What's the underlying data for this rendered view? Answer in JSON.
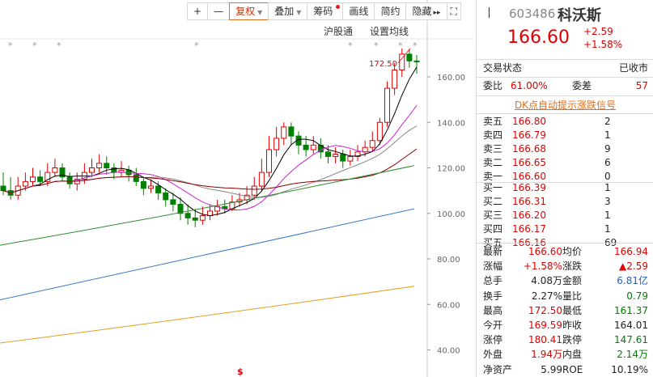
{
  "toolbar": {
    "plus": "+",
    "minus": "—",
    "fuquan": "复权",
    "diejia": "叠加",
    "chouma": "筹码",
    "huaxian": "画线",
    "jianyue": "简约",
    "yincang": "隐藏",
    "arrows": "▸▸",
    "expand": "⛶"
  },
  "chart_labels": {
    "hugutong": "沪股通",
    "setma": "设置均线",
    "max_price": "172.50",
    "s_marker": "$"
  },
  "yaxis": {
    "ticks": [
      "160.00",
      "140.00",
      "120.00",
      "100.00",
      "80.00",
      "60.00",
      "40.00"
    ]
  },
  "chart_data": {
    "type": "candlestick",
    "title": "",
    "ylim": [
      32,
      176
    ],
    "yticks": [
      160,
      140,
      120,
      100,
      80,
      60,
      40
    ],
    "candles": [
      [
        112,
        110,
        118,
        108
      ],
      [
        110,
        108,
        116,
        106
      ],
      [
        108,
        112,
        116,
        106
      ],
      [
        112,
        114,
        118,
        110
      ],
      [
        114,
        116,
        120,
        112
      ],
      [
        116,
        114,
        119,
        112
      ],
      [
        114,
        118,
        122,
        112
      ],
      [
        118,
        120,
        124,
        116
      ],
      [
        120,
        116,
        122,
        114
      ],
      [
        116,
        113,
        118,
        111
      ],
      [
        113,
        115,
        118,
        110
      ],
      [
        115,
        118,
        122,
        113
      ],
      [
        118,
        120,
        124,
        116
      ],
      [
        120,
        122,
        126,
        118
      ],
      [
        122,
        120,
        125,
        117
      ],
      [
        120,
        118,
        122,
        115
      ],
      [
        118,
        119,
        123,
        116
      ],
      [
        119,
        117,
        121,
        114
      ],
      [
        117,
        114,
        120,
        112
      ],
      [
        114,
        111,
        116,
        108
      ],
      [
        111,
        112,
        115,
        109
      ],
      [
        112,
        109,
        114,
        106
      ],
      [
        109,
        106,
        111,
        103
      ],
      [
        106,
        104,
        109,
        101
      ],
      [
        104,
        100,
        107,
        97
      ],
      [
        100,
        98,
        104,
        95
      ],
      [
        98,
        97,
        102,
        94
      ],
      [
        97,
        99,
        103,
        95
      ],
      [
        99,
        101,
        104,
        97
      ],
      [
        101,
        103,
        106,
        99
      ],
      [
        103,
        102,
        106,
        100
      ],
      [
        102,
        105,
        108,
        101
      ],
      [
        105,
        106,
        109,
        103
      ],
      [
        106,
        108,
        112,
        104
      ],
      [
        108,
        112,
        116,
        106
      ],
      [
        112,
        118,
        124,
        110
      ],
      [
        118,
        128,
        134,
        116
      ],
      [
        128,
        133,
        138,
        125
      ],
      [
        133,
        138,
        140,
        130
      ],
      [
        138,
        134,
        140,
        130
      ],
      [
        134,
        130,
        136,
        126
      ],
      [
        130,
        128,
        134,
        125
      ],
      [
        128,
        130,
        134,
        126
      ],
      [
        130,
        127,
        133,
        124
      ],
      [
        127,
        125,
        130,
        122
      ],
      [
        125,
        126,
        129,
        122
      ],
      [
        126,
        123,
        128,
        120
      ],
      [
        123,
        125,
        128,
        121
      ],
      [
        125,
        127,
        130,
        123
      ],
      [
        127,
        129,
        132,
        125
      ],
      [
        129,
        132,
        136,
        127
      ],
      [
        132,
        140,
        142,
        130
      ],
      [
        140,
        155,
        158,
        138
      ],
      [
        155,
        163,
        166,
        152
      ],
      [
        163,
        170,
        172.5,
        160
      ],
      [
        170,
        167,
        172,
        164
      ],
      [
        167,
        166.6,
        169.6,
        161.4
      ]
    ]
  },
  "quote": {
    "code": "603486",
    "name": "科沃斯",
    "price": "166.60",
    "change": "+2.59",
    "pct": "+1.58%",
    "status_label": "交易状态",
    "status_value": "已收市",
    "weibi_label": "委比",
    "weibi_value": "61.00%",
    "weicha_label": "委差",
    "weicha_value": "57",
    "dk_link": "DK点自动提示涨跌信号",
    "sell": [
      {
        "label": "卖五",
        "price": "166.80",
        "vol": "2"
      },
      {
        "label": "卖四",
        "price": "166.79",
        "vol": "1"
      },
      {
        "label": "卖三",
        "price": "166.68",
        "vol": "9"
      },
      {
        "label": "卖二",
        "price": "166.65",
        "vol": "6"
      },
      {
        "label": "卖一",
        "price": "166.60",
        "vol": "0"
      }
    ],
    "buy": [
      {
        "label": "买一",
        "price": "166.39",
        "vol": "1"
      },
      {
        "label": "买二",
        "price": "166.31",
        "vol": "3"
      },
      {
        "label": "买三",
        "price": "166.20",
        "vol": "1"
      },
      {
        "label": "买四",
        "price": "166.17",
        "vol": "1"
      },
      {
        "label": "买五",
        "price": "166.16",
        "vol": "69"
      }
    ],
    "stats": [
      {
        "l1": "最新",
        "v1": "166.60",
        "c1": "red",
        "l2": "均价",
        "v2": "166.94",
        "c2": "red"
      },
      {
        "l1": "涨幅",
        "v1": "+1.58%",
        "c1": "red",
        "l2": "涨跌",
        "v2": "▲2.59",
        "c2": "red"
      },
      {
        "l1": "总手",
        "v1": "4.08万",
        "c1": "",
        "l2": "金额",
        "v2": "6.81亿",
        "c2": "blu"
      },
      {
        "l1": "换手",
        "v1": "2.27%",
        "c1": "",
        "l2": "量比",
        "v2": "0.79",
        "c2": "grn"
      },
      {
        "l1": "最高",
        "v1": "172.50",
        "c1": "red",
        "l2": "最低",
        "v2": "161.37",
        "c2": "grn"
      },
      {
        "l1": "今开",
        "v1": "169.59",
        "c1": "red",
        "l2": "昨收",
        "v2": "164.01",
        "c2": ""
      },
      {
        "l1": "涨停",
        "v1": "180.41",
        "c1": "red",
        "l2": "跌停",
        "v2": "147.61",
        "c2": "grn"
      },
      {
        "l1": "外盘",
        "v1": "1.94万",
        "c1": "red",
        "l2": "内盘",
        "v2": "2.14万",
        "c2": "grn"
      },
      {
        "l1": "净资产",
        "v1": "5.99",
        "c1": "",
        "l2": "ROE",
        "v2": "10.19%",
        "c2": ""
      }
    ]
  },
  "colors": {
    "up": "#e00000",
    "down": "#008000",
    "accent": "#e07020"
  }
}
